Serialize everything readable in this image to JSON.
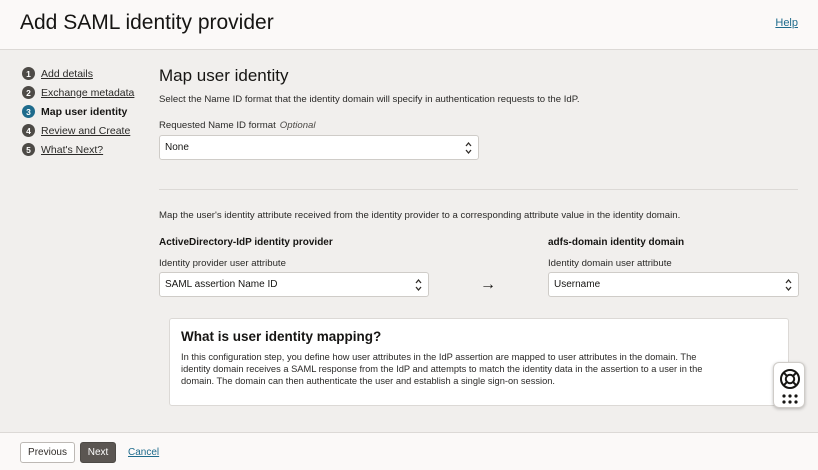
{
  "header": {
    "title": "Add SAML identity provider",
    "help_label": "Help"
  },
  "steps": [
    {
      "num": "1",
      "label": "Add details"
    },
    {
      "num": "2",
      "label": "Exchange metadata"
    },
    {
      "num": "3",
      "label": "Map user identity"
    },
    {
      "num": "4",
      "label": "Review and Create"
    },
    {
      "num": "5",
      "label": "What's Next?"
    }
  ],
  "main": {
    "section_title": "Map user identity",
    "section_description": "Select the Name ID format that the identity domain will specify in authentication requests to the IdP.",
    "name_id": {
      "label": "Requested Name ID format",
      "optional": "Optional",
      "value": "None"
    },
    "mapping_description": "Map the user's identity attribute received from the identity provider to a corresponding attribute value in the identity domain.",
    "provider": {
      "heading": "ActiveDirectory-IdP identity provider",
      "label": "Identity provider user attribute",
      "value": "SAML assertion Name ID"
    },
    "arrow": "→",
    "domain": {
      "heading": "adfs-domain identity domain",
      "label": "Identity domain user attribute",
      "value": "Username"
    }
  },
  "info": {
    "title": "What is user identity mapping?",
    "lines": [
      "In this configuration step, you define how user attributes in the IdP assertion are mapped to user attributes in the domain. The",
      "identity domain receives a SAML response from the IdP and attempts to match the identity data in the assertion to a user in the",
      "domain. The domain can then authenticate the user and establish a single sign-on session."
    ]
  },
  "footer": {
    "previous": "Previous",
    "next": "Next",
    "cancel": "Cancel"
  },
  "icons": {
    "floating_top": "lifebuoy-icon",
    "floating_bottom": "apps-grid-icon"
  },
  "colors": {
    "link": "#1e6b8c",
    "active_step": "#1e6b8c",
    "primary_button": "#5b5652"
  }
}
